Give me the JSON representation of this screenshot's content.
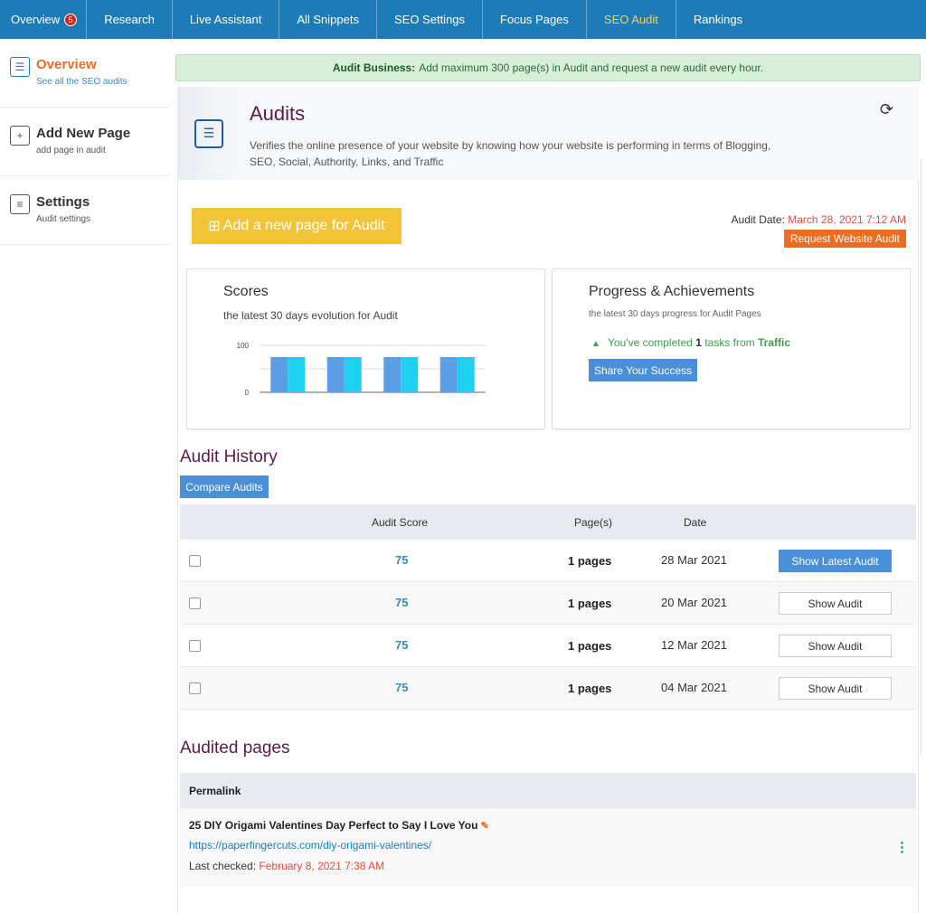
{
  "nav": {
    "items": [
      {
        "label": "Overview",
        "badge": "5"
      },
      {
        "label": "Research"
      },
      {
        "label": "Live Assistant"
      },
      {
        "label": "All Snippets"
      },
      {
        "label": "SEO Settings"
      },
      {
        "label": "Focus Pages"
      },
      {
        "label": "SEO Audit",
        "active": true
      },
      {
        "label": "Rankings"
      }
    ]
  },
  "sidebar": {
    "items": [
      {
        "title": "Overview",
        "sub": "See all the SEO audits",
        "icon": "checklist-icon"
      },
      {
        "title": "Add New Page",
        "sub": "add page in audit",
        "icon": "plus-icon"
      },
      {
        "title": "Settings",
        "sub": "Audit settings",
        "icon": "sliders-icon"
      }
    ]
  },
  "notice": {
    "bold": "Audit Business:",
    "text": "Add maximum 300 page(s) in Audit and request a new audit every hour."
  },
  "header": {
    "title": "Audits",
    "description": "Verifies the online presence of your website by knowing how your website is performing in terms of Blogging, SEO, Social, Authority, Links, and Traffic"
  },
  "actions": {
    "add_label": "Add a new page for Audit",
    "audit_date_label": "Audit Date:",
    "audit_date_value": "March 28, 2021 7:12 AM",
    "request_label": "Request Website Audit"
  },
  "scores": {
    "title": "Scores",
    "sub": "the latest 30 days evolution for Audit"
  },
  "chart_data": {
    "type": "bar",
    "categories": [
      "",
      "",
      "",
      ""
    ],
    "series": [
      {
        "values": [
          75,
          75,
          75,
          75
        ],
        "color": "#5b9ee6"
      },
      {
        "values": [
          75,
          75,
          75,
          75
        ],
        "color": "#1fd0ef"
      }
    ],
    "ylim": [
      0,
      100
    ],
    "yticks": [
      "0",
      "100"
    ]
  },
  "progress": {
    "title": "Progress & Achievements",
    "sub": "the latest 30 days progress for Audit Pages",
    "line_pre": "You've completed",
    "count": "1",
    "line_mid": "tasks from",
    "source": "Traffic",
    "share_label": "Share Your Success"
  },
  "history": {
    "title": "Audit History",
    "compare_label": "Compare Audits",
    "headers": {
      "score": "Audit Score",
      "pages": "Page(s)",
      "date": "Date"
    },
    "rows": [
      {
        "score": "75",
        "pages": "1 pages",
        "date": "28 Mar 2021",
        "button": "Show Latest Audit"
      },
      {
        "score": "75",
        "pages": "1 pages",
        "date": "20 Mar 2021",
        "button": "Show Audit"
      },
      {
        "score": "75",
        "pages": "1 pages",
        "date": "12 Mar 2021",
        "button": "Show Audit"
      },
      {
        "score": "75",
        "pages": "1 pages",
        "date": "04 Mar 2021",
        "button": "Show Audit"
      }
    ]
  },
  "audited": {
    "title": "Audited pages",
    "header": "Permalink",
    "rows": [
      {
        "title": "25 DIY Origami Valentines Day Perfect to Say I Love You",
        "url": "https://paperfingercuts.com/diy-origami-valentines/",
        "checked_label": "Last checked:",
        "checked_value": "February 8, 2021 7:38 AM"
      }
    ]
  },
  "colors": {
    "nav_bg": "#1d7cb8",
    "active_nav": "#f2d546",
    "accent_orange": "#ee6c1f",
    "title_purple": "#5b1a4a",
    "button_blue": "#4a90d9",
    "add_yellow": "#f2c438"
  }
}
